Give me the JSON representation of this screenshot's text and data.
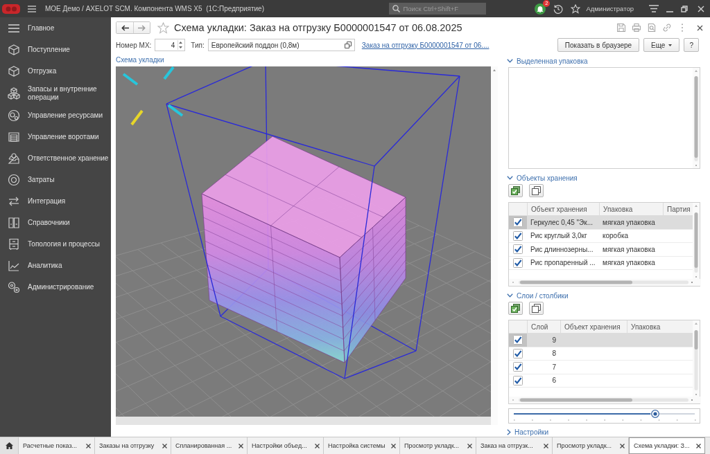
{
  "window": {
    "title": "МОЕ Демо / AXELOT SCM. Компонента WMS X5  (1С:Предприятие)",
    "search_placeholder": "Поиск Ctrl+Shift+F",
    "notifications": "2",
    "user": "Администратор"
  },
  "sidebar": {
    "items": [
      {
        "label": "Главное"
      },
      {
        "label": "Поступление"
      },
      {
        "label": "Отгрузка"
      },
      {
        "label": "Запасы и внутренние операции"
      },
      {
        "label": "Управление ресурсами"
      },
      {
        "label": "Управление воротами"
      },
      {
        "label": "Ответственное хранение"
      },
      {
        "label": "Затраты"
      },
      {
        "label": "Интеграция"
      },
      {
        "label": "Справочники"
      },
      {
        "label": "Топология и процессы"
      },
      {
        "label": "Аналитика"
      },
      {
        "label": "Администрирование"
      }
    ]
  },
  "form": {
    "title": "Схема укладки: Заказ на отгрузку Б0000001547 от 06.08.2025",
    "favorite": false,
    "fields": {
      "number_label": "Номер МХ:",
      "number_value": "4",
      "type_label": "Тип:",
      "type_value": "Европейский поддон (0,8м)",
      "order_link": "Заказ на отгрузку Б0000001547 от 06...."
    },
    "buttons": {
      "show_in_browser": "Показать в браузере",
      "more": "Еще",
      "help": "?"
    }
  },
  "scheme": {
    "label": "Схема укладки"
  },
  "selected_package": {
    "title": "Выделенная упаковка",
    "expanded": true
  },
  "storage_objects": {
    "title": "Объекты хранения",
    "expanded": true,
    "columns": [
      "Объект хранения",
      "Упаковка",
      "Партия"
    ],
    "rows": [
      {
        "checked": true,
        "selected": true,
        "object": "Геркулес 0,45 \"Эк...",
        "package": "мягкая упаковка"
      },
      {
        "checked": true,
        "selected": false,
        "object": "Рис круглый 3,0кг",
        "package": "коробка"
      },
      {
        "checked": true,
        "selected": false,
        "object": "Рис длиннозерны...",
        "package": "мягкая упаковка"
      },
      {
        "checked": true,
        "selected": false,
        "object": "Рис пропаренный ...",
        "package": "мягкая упаковка"
      }
    ]
  },
  "layers": {
    "title": "Слои / столбики",
    "expanded": true,
    "columns": [
      "Слой",
      "Объект хранения",
      "Упаковка"
    ],
    "rows": [
      {
        "checked": true,
        "selected": true,
        "layer": "9"
      },
      {
        "checked": true,
        "selected": false,
        "layer": "8"
      },
      {
        "checked": true,
        "selected": false,
        "layer": "7"
      },
      {
        "checked": true,
        "selected": false,
        "layer": "6"
      }
    ]
  },
  "slider": {
    "level": 0.78
  },
  "settings": {
    "title": "Настройки",
    "expanded": false
  },
  "open_tabs": [
    {
      "label": "Расчетные показ...",
      "selected": false
    },
    {
      "label": "Заказы на отгрузку",
      "selected": false
    },
    {
      "label": "Спланированная ...",
      "selected": false
    },
    {
      "label": "Настройки объед...",
      "selected": false
    },
    {
      "label": "Настройка системы",
      "selected": false
    },
    {
      "label": "Просмотр укладк...",
      "selected": false
    },
    {
      "label": "Заказ на отгрузк...",
      "selected": false
    },
    {
      "label": "Просмотр укладк...",
      "selected": false
    },
    {
      "label": "Схема укладки: З...",
      "selected": true
    }
  ]
}
